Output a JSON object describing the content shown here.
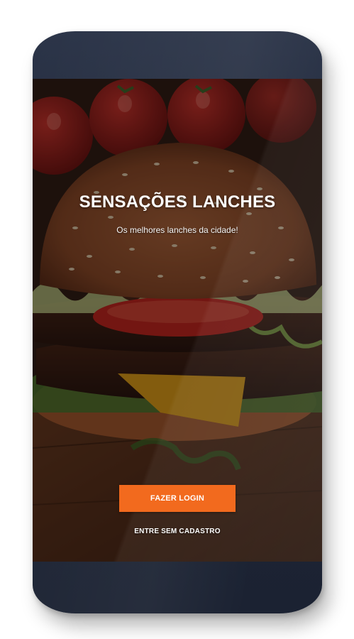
{
  "app": {
    "title": "SENSAÇÕES LANCHES",
    "tagline": "Os melhores lanches da cidade!"
  },
  "actions": {
    "login_label": "FAZER LOGIN",
    "guest_label": "ENTRE SEM CADASTRO"
  },
  "background": {
    "description_icon": "burger-photo"
  },
  "colors": {
    "accent": "#f26a1e",
    "phone_body": "#1f2738",
    "text": "#ffffff"
  }
}
